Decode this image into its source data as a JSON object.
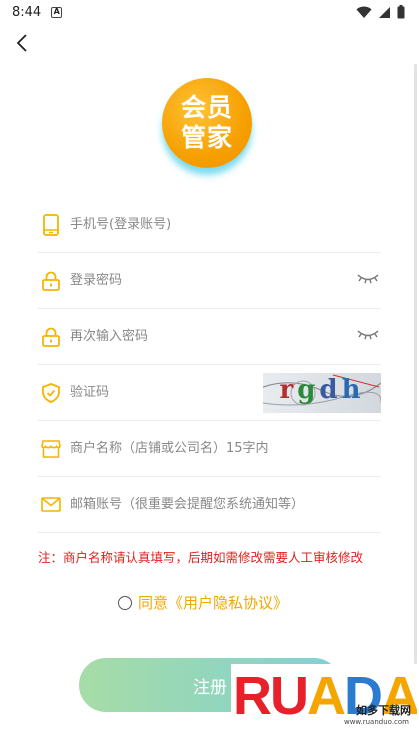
{
  "status_bar": {
    "time": "8:44",
    "notification_letter": "A"
  },
  "logo": {
    "line1": "会员",
    "line2": "管家"
  },
  "form": {
    "phone_placeholder": "手机号(登录账号)",
    "password_placeholder": "登录密码",
    "password_confirm_placeholder": "再次输入密码",
    "captcha_placeholder": "验证码",
    "captcha_text": "rgdh",
    "shop_name_placeholder": "商户名称（店铺或公司名）15字内",
    "email_placeholder": "邮箱账号（很重要会提醒您系统通知等）"
  },
  "note": "注：商户名称请认真填写，后期如需修改需要人工审核修改",
  "agreement": {
    "agree_text": "同意",
    "link_text": "《用户隐私协议》"
  },
  "register_button": "注册",
  "watermark": {
    "brand": "RUANDADUO",
    "cn": "如多下载网",
    "url": "www.ruanduo.com"
  },
  "colors": {
    "accent": "#f0a800",
    "note": "#e02020",
    "button_start": "#a7dca6",
    "button_end": "#7fd0d8",
    "icon": "#f5b400"
  }
}
